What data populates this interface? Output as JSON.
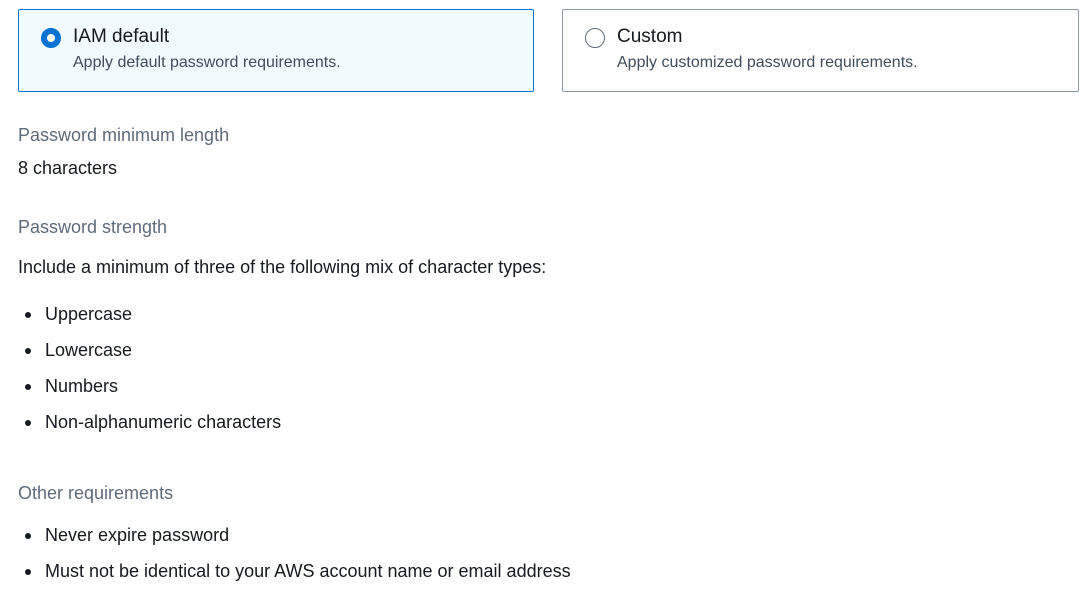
{
  "policy_options": [
    {
      "title": "IAM default",
      "description": "Apply default password requirements.",
      "selected": true
    },
    {
      "title": "Custom",
      "description": "Apply customized password requirements.",
      "selected": false
    }
  ],
  "min_length": {
    "label": "Password minimum length",
    "value": "8 characters"
  },
  "strength": {
    "label": "Password strength",
    "intro": "Include a minimum of three of the following mix of character types:",
    "items": [
      "Uppercase",
      "Lowercase",
      "Numbers",
      "Non-alphanumeric characters"
    ]
  },
  "other": {
    "label": "Other requirements",
    "items": [
      "Never expire password",
      "Must not be identical to your AWS account name or email address"
    ]
  },
  "colors": {
    "accent": "#0972d3",
    "selected_background": "#f1faff",
    "label_text": "#5f6b7a",
    "body_text": "#16191f"
  }
}
